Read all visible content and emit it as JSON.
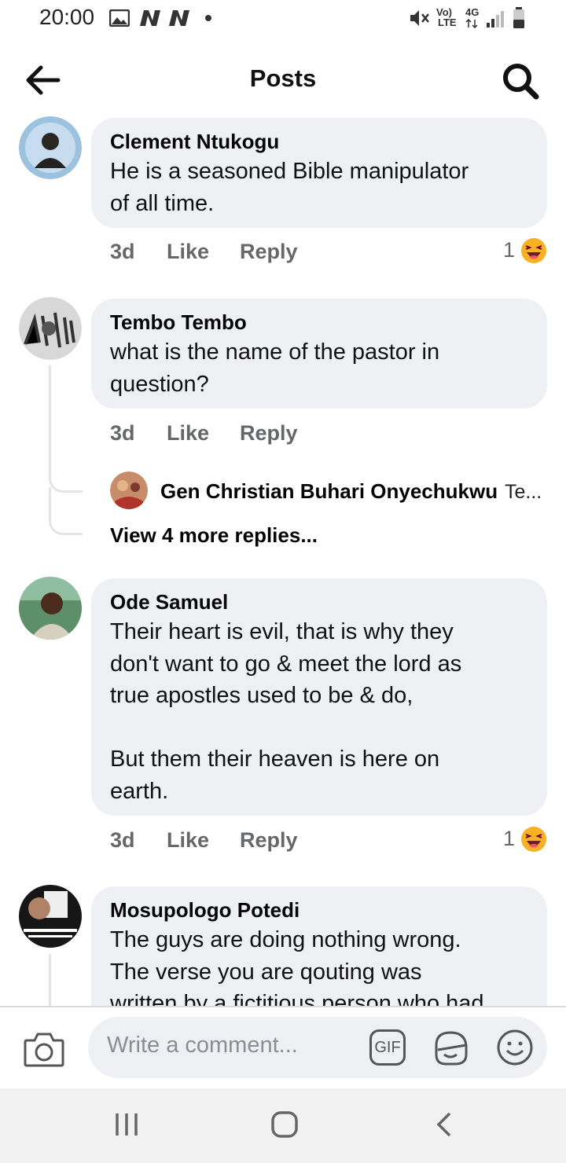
{
  "status": {
    "time": "20:00",
    "network_vol": "Vo)",
    "network_lte": "LTE",
    "network_4g": "4G"
  },
  "header": {
    "title": "Posts",
    "back_icon": "arrow-left-icon",
    "search_icon": "search-icon"
  },
  "comments": [
    {
      "author": "Clement Ntukogu",
      "text": "He is a seasoned Bible manipulator\nof all time.",
      "age": "3d",
      "like": "Like",
      "reply": "Reply",
      "reactions": "1",
      "reaction_icon": "laughing-emoji-icon"
    },
    {
      "author": "Tembo Tembo",
      "text": "what is the name of the pastor in\nquestion?",
      "age": "3d",
      "like": "Like",
      "reply": "Reply",
      "reply_preview": {
        "author": "Gen Christian Buhari Onyechukwu",
        "snippet": "Te..."
      },
      "view_more": "View 4 more replies..."
    },
    {
      "author": "Ode Samuel",
      "text": "Their heart is evil, that is why they\ndon't want to go & meet the lord as\ntrue apostles used to be & do,\n\nBut them their heaven is here on\nearth.",
      "age": "3d",
      "like": "Like",
      "reply": "Reply",
      "reactions": "1",
      "reaction_icon": "laughing-emoji-icon"
    },
    {
      "author": "Mosupologo Potedi",
      "text": "The guys are doing nothing wrong.\nThe verse you are qouting was\nwritten by a fictitious person who had"
    }
  ],
  "composer": {
    "placeholder": "Write a comment...",
    "gif_label": "GIF",
    "camera_icon": "camera-icon",
    "sticker_icon": "sticker-icon",
    "emoji_icon": "smiley-icon"
  },
  "navbar": {
    "recents_icon": "recent-apps-icon",
    "home_icon": "home-icon",
    "back_icon": "nav-back-icon"
  }
}
